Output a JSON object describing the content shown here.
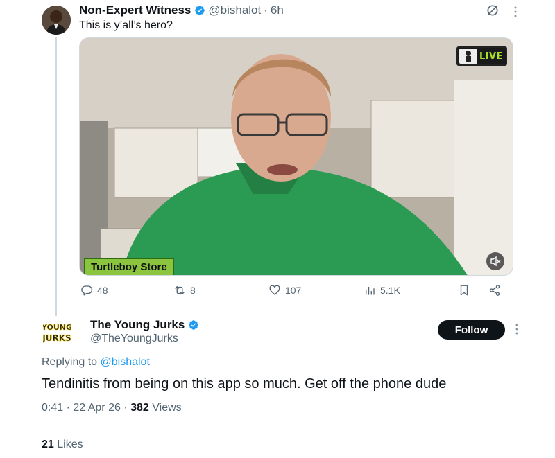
{
  "parent_tweet": {
    "author_name": "Non-Expert Witness",
    "handle": "@bishalot",
    "separator": "·",
    "time": "6h",
    "text": "This is y’all’s hero?",
    "media": {
      "live_badge": "LIVE",
      "store_label": "Turtleboy Store"
    },
    "actions": {
      "replies": "48",
      "reposts": "8",
      "likes": "107",
      "views": "5.1K"
    }
  },
  "reply_tweet": {
    "author_name": "The Young Jurks",
    "handle": "@TheYoungJurks",
    "avatar_text": "YOUNG JURKS",
    "follow_label": "Follow",
    "replying_prefix": "Replying to",
    "replying_to": "@bishalot",
    "text": "Tendinitis from being on this app so much. Get off the phone dude",
    "time": "0:41",
    "date": "22 Apr 26",
    "separator": "·",
    "views_count": "382",
    "views_label": "Views",
    "likes_count": "21",
    "likes_label": "Likes"
  },
  "colors": {
    "accent": "#1d9bf0",
    "text_primary": "#0f1419",
    "text_secondary": "#536471",
    "follow_button_bg": "#0f1419",
    "store_tag_bg": "#8bc53f",
    "live_text": "#a6e12b"
  },
  "icons": [
    "verified-badge-icon",
    "grok-icon",
    "more-icon",
    "reply-icon",
    "repost-icon",
    "like-icon",
    "views-icon",
    "bookmark-icon",
    "share-icon",
    "mute-icon"
  ]
}
